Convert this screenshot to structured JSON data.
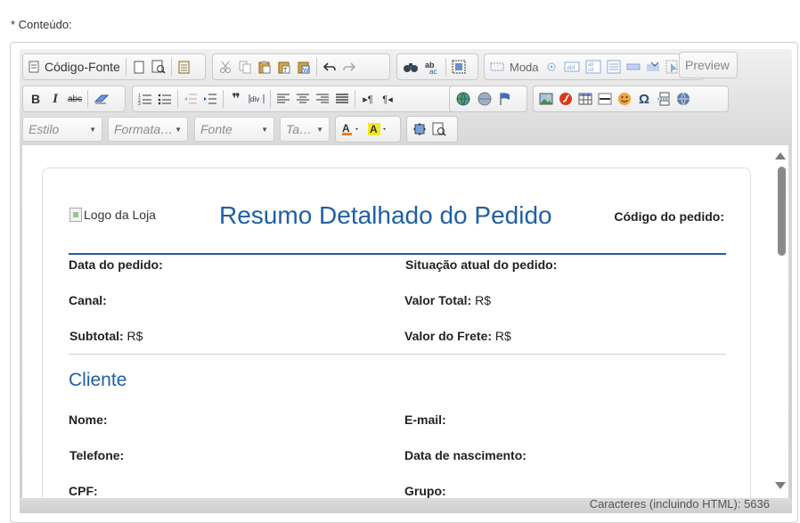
{
  "field_label": "* Conteúdo:",
  "toolbar": {
    "source_label": "Código-Fonte",
    "moda_label": "Moda",
    "preview_label": "Preview",
    "combos": {
      "style": "Estilo",
      "format": "Formata…",
      "font": "Fonte",
      "size": "Ta…"
    }
  },
  "document": {
    "logo_alt": "Logo da Loja",
    "title": "Resumo Detalhado do Pedido",
    "order_code_label": "Código do pedido:",
    "fields": {
      "order_date": "Data do pedido:",
      "status": "Situação atual do pedido:",
      "channel": "Canal:",
      "total_value": "Valor Total:",
      "total_value_suffix": "R$",
      "subtotal": "Subtotal:",
      "subtotal_suffix": "R$",
      "shipping": "Valor do Frete:",
      "shipping_suffix": "R$"
    },
    "client_section": {
      "title": "Cliente",
      "name": "Nome:",
      "email": "E-mail:",
      "phone": "Telefone:",
      "birth_date": "Data de nascimento:",
      "cpf": "CPF:",
      "group": "Grupo:"
    }
  },
  "status_bar": {
    "char_count": "Caracteres (incluindo HTML): 5636"
  },
  "colors": {
    "title_blue": "#1f5fa6",
    "rule_blue": "#2a5d9b"
  }
}
